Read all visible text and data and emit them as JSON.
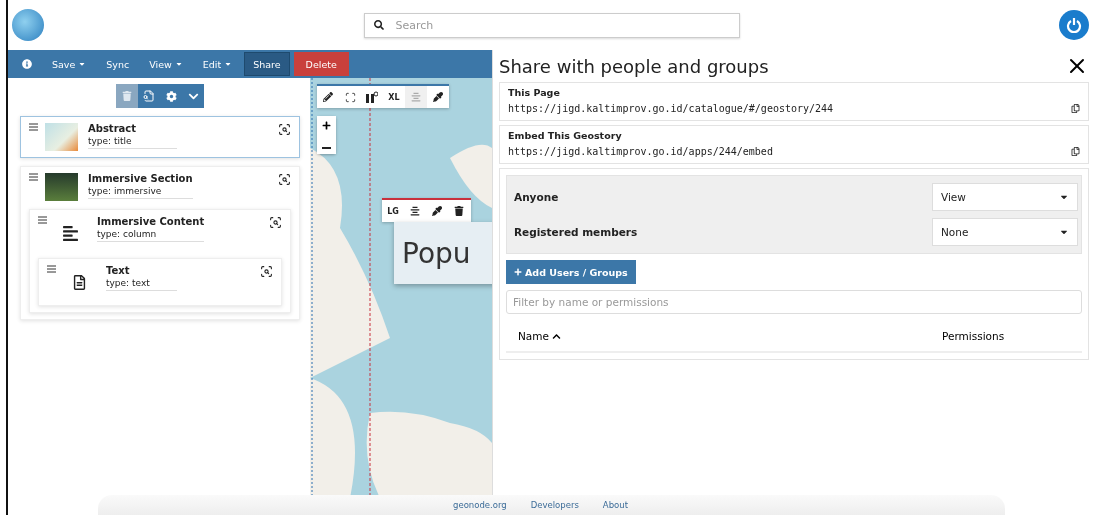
{
  "header": {
    "search": {
      "placeholder": "Search"
    }
  },
  "toolbar": {
    "items": [
      {
        "kind": "info"
      },
      {
        "kind": "dropdown",
        "label": "Save"
      },
      {
        "kind": "plain",
        "label": "Sync"
      },
      {
        "kind": "dropdown",
        "label": "View"
      },
      {
        "kind": "dropdown",
        "label": "Edit"
      },
      {
        "kind": "active",
        "label": "Share"
      },
      {
        "kind": "danger",
        "label": "Delete"
      }
    ]
  },
  "tree_toolbar": {
    "delete_disabled": true
  },
  "sections": [
    {
      "kind": "map",
      "title": "Abstract",
      "type": "type: title",
      "selected": true
    },
    {
      "kind": "photo",
      "title": "Immersive Section",
      "type": "type: immersive",
      "selected": false,
      "children": [
        {
          "kind": "column",
          "title": "Immersive Content",
          "type": "type: column",
          "selected": false,
          "children": [
            {
              "kind": "text",
              "title": "Text",
              "type": "type: text",
              "selected": false
            }
          ]
        }
      ]
    }
  ],
  "map": {
    "size_label": "XL",
    "overlay": {
      "size_label": "LG",
      "heading": "Popu"
    }
  },
  "share": {
    "title": "Share with people and groups",
    "links": [
      {
        "label": "This Page",
        "url": "https://jigd.kaltimprov.go.id/catalogue/#/geostory/244"
      },
      {
        "label": "Embed This Geostory",
        "url": "https://jigd.kaltimprov.go.id/apps/244/embed"
      }
    ],
    "permissions": [
      {
        "label": "Anyone",
        "value": "View"
      },
      {
        "label": "Registered members",
        "value": "None"
      }
    ],
    "add_button": "Add Users / Groups",
    "filter": {
      "placeholder": "Filter by name or permissions"
    },
    "columns": [
      {
        "label": "Name",
        "sorted": true
      },
      {
        "label": "Permissions",
        "sorted": false
      }
    ]
  },
  "footer": {
    "links": [
      "geonode.org",
      "Developers",
      "About"
    ]
  }
}
